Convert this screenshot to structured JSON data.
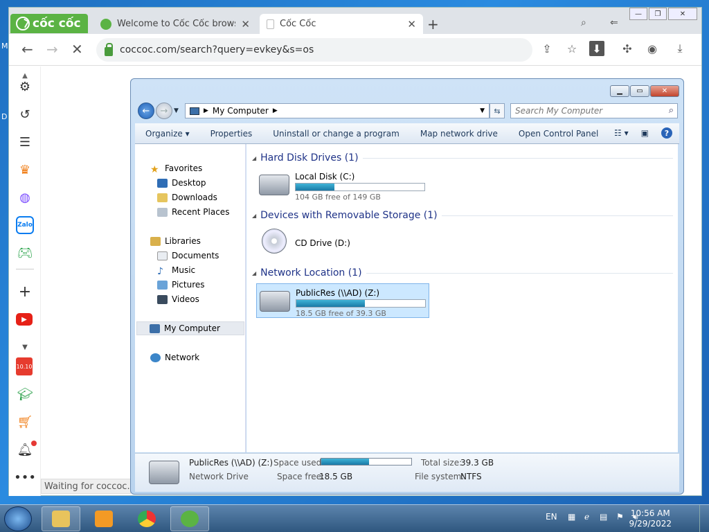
{
  "desktop_edge": {
    "c1": "M",
    "c2": "D"
  },
  "browser": {
    "brand": "cốc cốc",
    "tabs": [
      {
        "title": "Welcome to Cốc Cốc browse",
        "close": "✕"
      },
      {
        "title": "Cốc Cốc",
        "close": "✕"
      }
    ],
    "new_tab": "+",
    "url": "coccoc.com/search?query=evkey&s=os",
    "status": "Waiting for coccoc.c",
    "window_controls": {
      "min": "—",
      "max": "❐",
      "close": "✕"
    }
  },
  "sidebar": {
    "icons": [
      "settings-icon",
      "history-icon",
      "notes-icon",
      "crown-icon",
      "messenger-icon",
      "zalo-icon",
      "game-icon",
      "add-icon",
      "youtube-icon",
      "more-down-icon",
      "shopee-icon",
      "education-icon",
      "shopping-icon",
      "bell-icon",
      "more-icon"
    ],
    "zalo_label": "Zalo"
  },
  "explorer": {
    "breadcrumb": "My Computer",
    "search_placeholder": "Search My Computer",
    "commands": [
      "Organize ▾",
      "Properties",
      "Uninstall or change a program",
      "Map network drive",
      "Open Control Panel"
    ],
    "nav": {
      "favorites": "Favorites",
      "desktop": "Desktop",
      "downloads": "Downloads",
      "recent": "Recent Places",
      "libraries": "Libraries",
      "documents": "Documents",
      "music": "Music",
      "pictures": "Pictures",
      "videos": "Videos",
      "my_computer": "My Computer",
      "network": "Network"
    },
    "groups": {
      "hdd": "Hard Disk Drives (1)",
      "removable": "Devices with Removable Storage (1)",
      "network": "Network Location (1)"
    },
    "drives": {
      "c": {
        "name": "Local Disk (C:)",
        "free": "104 GB free of 149 GB",
        "used_fraction": 0.3
      },
      "d": {
        "name": "CD Drive (D:)"
      },
      "z": {
        "name": "PublicRes (\\\\AD) (Z:)",
        "free": "18.5 GB free of 39.3 GB",
        "used_fraction": 0.53
      }
    },
    "details": {
      "name": "PublicRes (\\\\AD) (Z:)",
      "type": "Network Drive",
      "space_used_label": "Space used:",
      "space_free_label": "Space free:",
      "space_free": "18.5 GB",
      "total_size_label": "Total size:",
      "total_size": "39.3 GB",
      "fs_label": "File system:",
      "fs": "NTFS",
      "used_fraction": 0.53
    }
  },
  "taskbar": {
    "lang": "EN",
    "time": "10:56 AM",
    "date": "9/29/2022"
  }
}
